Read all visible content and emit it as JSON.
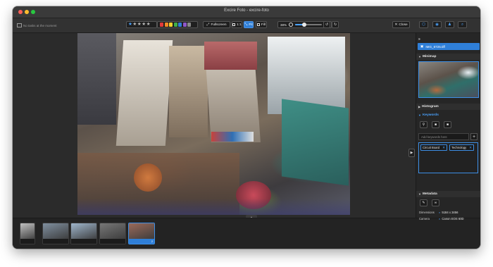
{
  "window": {
    "title": "Excire Foto - excire-foto"
  },
  "toolbar": {
    "tasks_status": "No tasks at the moment",
    "rating": {
      "value": 1,
      "max": 5
    },
    "color_labels": [
      "#e23b3b",
      "#f08a24",
      "#f2d22e",
      "#3fae49",
      "#2f7fd8",
      "#8e57c9",
      "#8a8a8a"
    ],
    "fullscreen_label": "Fullscreen",
    "one_to_one_label": "1:1",
    "fit_label": "Fit",
    "fill_label": "Fill",
    "zoom_value": "38%",
    "zoom_fraction": 0.35,
    "close_label": "Close",
    "right_icons": [
      "share-icon",
      "face-icon",
      "people-icon",
      "search-icon"
    ]
  },
  "sidebar": {
    "file_name": "IMG_6725.tiff",
    "sections": {
      "minimap": "Minimap",
      "histogram": "Histogram",
      "keywords": "Keywords",
      "metadata": "Metadata"
    },
    "keyword_placeholder": "Add keywords here",
    "keywords": [
      "Circuit Board",
      "Technology"
    ],
    "metadata_rows": [
      {
        "key": "Dimensions",
        "value": "5184 x 3456"
      },
      {
        "key": "Camera",
        "value": "Canon EOS 60D"
      }
    ]
  },
  "filmstrip": {
    "thumbs": [
      {
        "left": "",
        "right": "",
        "tone": "#bfbfbf"
      },
      {
        "left": "",
        "right": "",
        "tone": "#7f8f9f"
      },
      {
        "left": "",
        "right": "",
        "tone": "#9fb6cc"
      },
      {
        "left": "",
        "right": "",
        "tone": "#777777"
      },
      {
        "left": "",
        "right": "2",
        "tone": "#9a6a5a"
      }
    ]
  }
}
